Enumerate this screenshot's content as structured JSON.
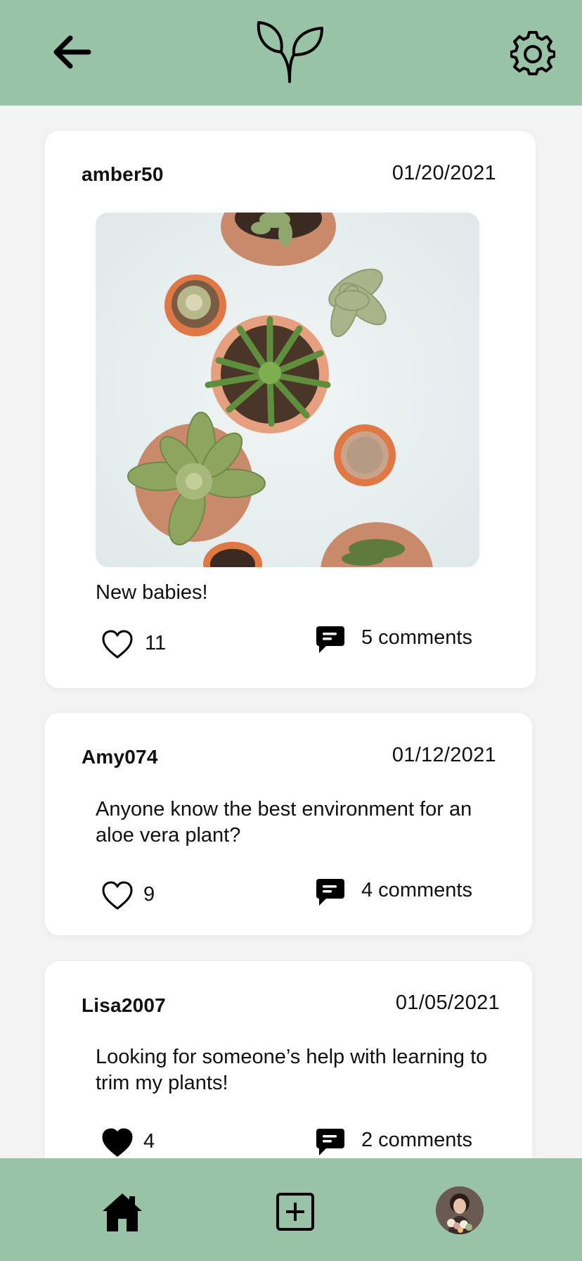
{
  "header": {
    "back_icon": "arrow-left-icon",
    "logo_icon": "sprout-icon",
    "settings_icon": "gear-icon",
    "background": "#98c3a6"
  },
  "posts": [
    {
      "username": "amber50",
      "date": "01/20/2021",
      "caption": "New babies!",
      "likes": "11",
      "liked": false,
      "comments": "5 comments"
    },
    {
      "username": "Amy074",
      "date": "01/12/2021",
      "text": "Anyone know the best environment for an aloe vera plant?",
      "likes": "9",
      "liked": false,
      "comments": "4 comments"
    },
    {
      "username": "Lisa2007",
      "date": "01/05/2021",
      "text": "Looking for someone’s help with learning to trim my plants!",
      "likes": "4",
      "liked": true,
      "comments": "2 comments"
    }
  ],
  "bottom_nav": {
    "home_icon": "home-icon",
    "add_icon": "add-post-icon",
    "profile_icon": "avatar",
    "background": "#98c3a6"
  }
}
